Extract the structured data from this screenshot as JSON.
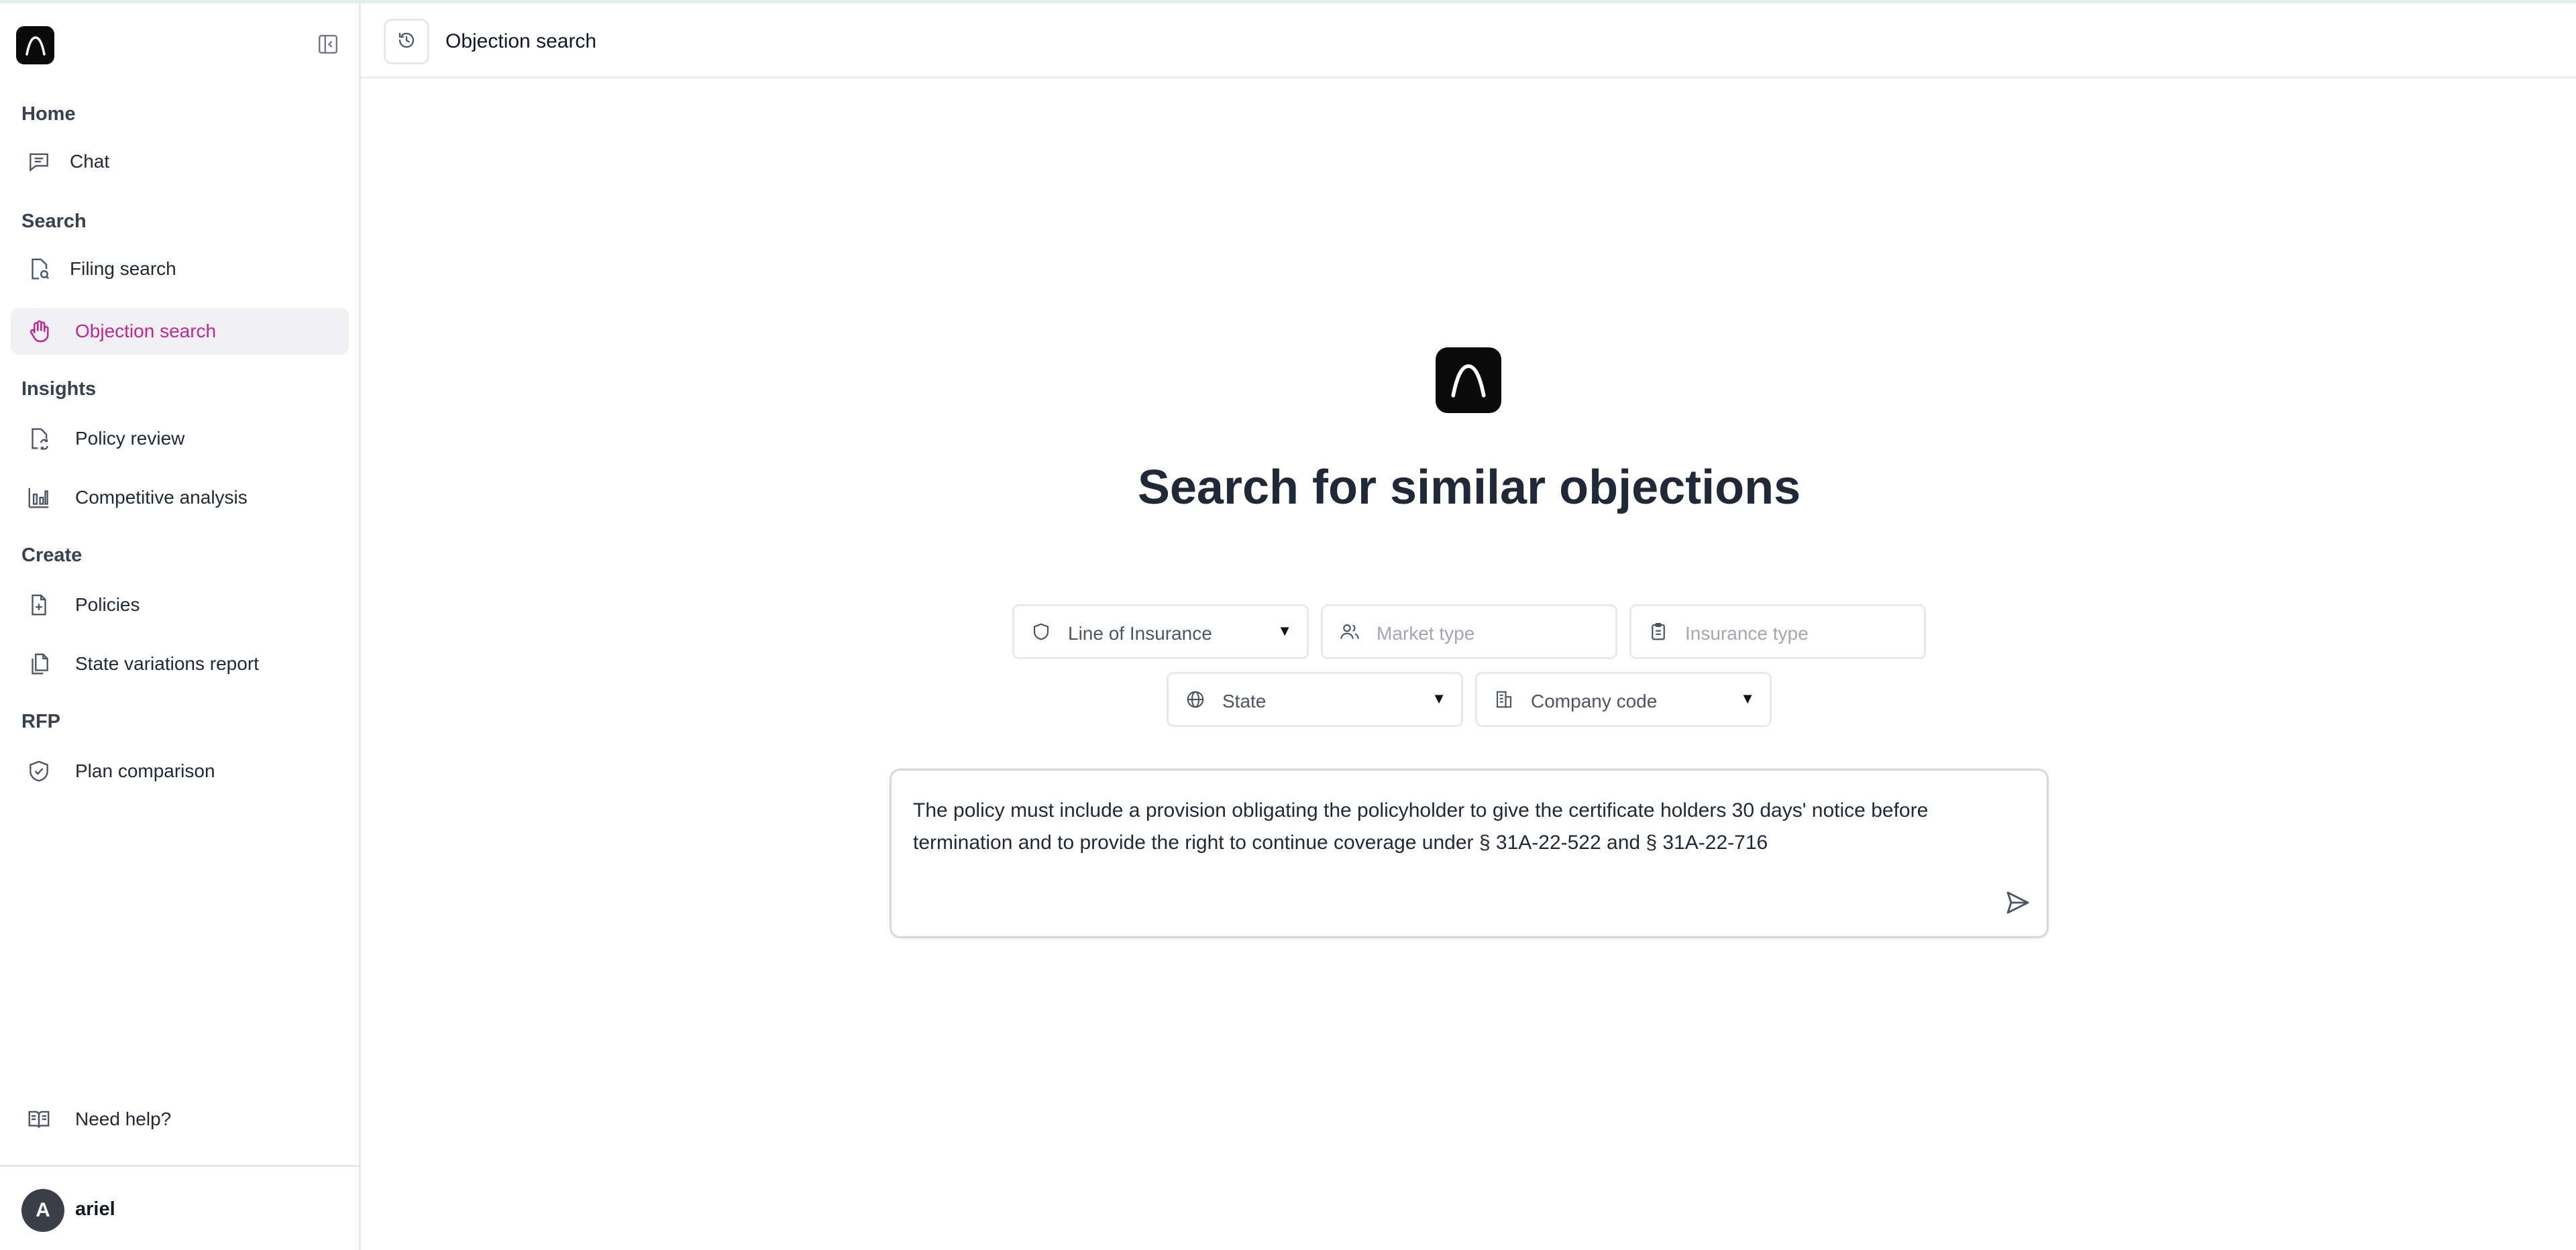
{
  "header": {
    "title": "Objection search",
    "history_icon": "history-icon"
  },
  "sidebar": {
    "sections": {
      "home": "Home",
      "search": "Search",
      "insights": "Insights",
      "create": "Create",
      "rfp": "RFP"
    },
    "items": {
      "chat": "Chat",
      "filing_search": "Filing search",
      "objection_search": "Objection search",
      "policy_review": "Policy review",
      "competitive_analysis": "Competitive analysis",
      "policies": "Policies",
      "state_variations_report": "State variations report",
      "plan_comparison": "Plan comparison",
      "need_help": "Need help?"
    },
    "active_item": "Objection search",
    "user": {
      "initial": "A",
      "name": "ariel"
    }
  },
  "main": {
    "heading": "Search for similar objections",
    "filters": {
      "line_of_insurance": "Line of Insurance",
      "market_type_placeholder": "Market type",
      "insurance_type_placeholder": "Insurance type",
      "state": "State",
      "company_code": "Company code"
    },
    "query": "The policy must include a provision obligating the policyholder to give the certificate holders 30 days' notice before termination and to provide the right to continue coverage under § 31A-22-522 and § 31A-22-716"
  },
  "colors": {
    "accent": "#c0269a",
    "active_bg": "#f1f1f4",
    "logo_bg": "#0a0a0a"
  }
}
